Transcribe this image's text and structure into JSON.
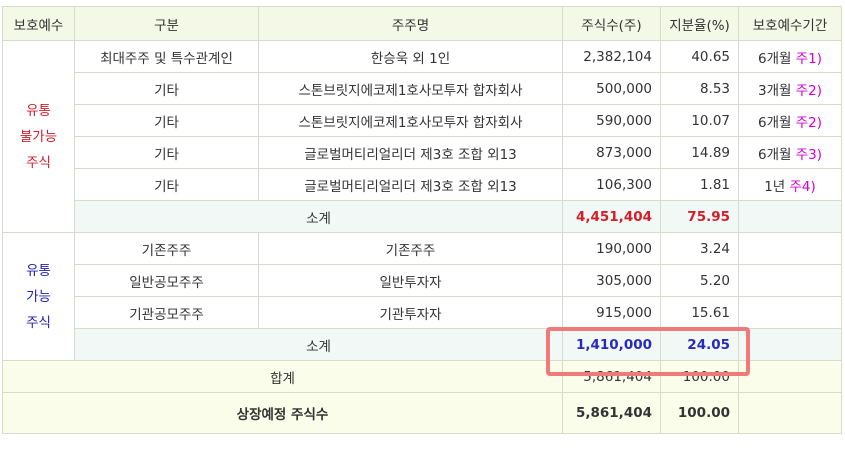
{
  "headers": [
    "보호예수",
    "구분",
    "주주명",
    "주식수(주)",
    "지분율(%)",
    "보호예수기간"
  ],
  "locked": {
    "group_label_lines": [
      "유통",
      "불가능",
      "주식"
    ],
    "rows": [
      {
        "category": "최대주주 및 특수관계인",
        "holder": "한승욱 외 1인",
        "shares": "2,382,104",
        "ratio": "40.65",
        "period": "6개월",
        "note": "주1)"
      },
      {
        "category": "기타",
        "holder": "스톤브릿지에코제1호사모투자 합자회사",
        "shares": "500,000",
        "ratio": "8.53",
        "period": "3개월",
        "note": "주2)"
      },
      {
        "category": "기타",
        "holder": "스톤브릿지에코제1호사모투자 합자회사",
        "shares": "590,000",
        "ratio": "10.07",
        "period": "6개월",
        "note": "주2)"
      },
      {
        "category": "기타",
        "holder": "글로벌머티리얼리더 제3호 조합 외13",
        "shares": "873,000",
        "ratio": "14.89",
        "period": "6개월",
        "note": "주3)"
      },
      {
        "category": "기타",
        "holder": "글로벌머티리얼리더 제3호 조합 외13",
        "shares": "106,300",
        "ratio": "1.81",
        "period": "1년",
        "note": "주4)"
      }
    ],
    "subtotal": {
      "label": "소계",
      "shares": "4,451,404",
      "ratio": "75.95"
    }
  },
  "tradable": {
    "group_label_lines": [
      "유통",
      "가능",
      "주식"
    ],
    "rows": [
      {
        "category": "기존주주",
        "holder": "기존주주",
        "shares": "190,000",
        "ratio": "3.24"
      },
      {
        "category": "일반공모주주",
        "holder": "일반투자자",
        "shares": "305,000",
        "ratio": "5.20"
      },
      {
        "category": "기관공모주주",
        "holder": "기관투자자",
        "shares": "915,000",
        "ratio": "15.61"
      }
    ],
    "subtotal": {
      "label": "소계",
      "shares": "1,410,000",
      "ratio": "24.05"
    }
  },
  "total": {
    "label": "합계",
    "shares": "5,861,404",
    "ratio": "100.00"
  },
  "listed": {
    "label": "상장예정 주식수",
    "shares": "5,861,404",
    "ratio": "100.00"
  },
  "colors": {
    "highlight_box": "#f07a7a",
    "header_bg": "#f4f8e6",
    "locked_label": "#d11f2a",
    "tradable_label": "#2222aa",
    "note": "#d400d4"
  }
}
